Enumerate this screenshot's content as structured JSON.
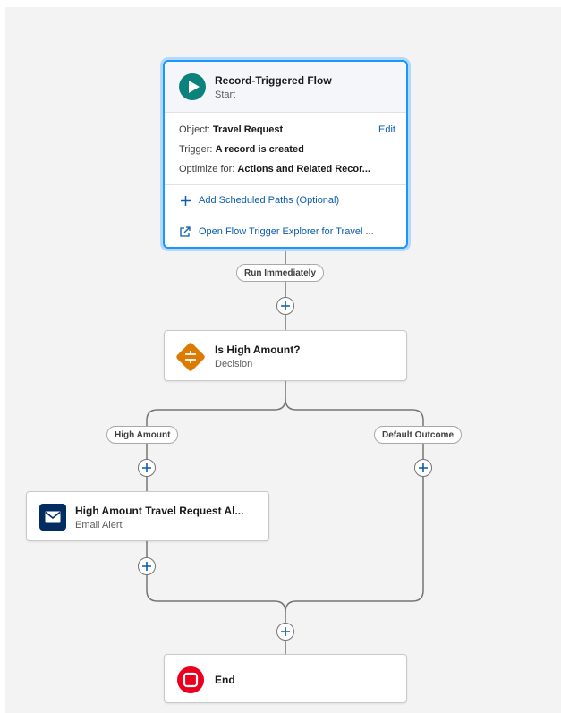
{
  "start": {
    "title": "Record-Triggered Flow",
    "subtitle": "Start",
    "object_label": "Object:",
    "object_value": "Travel Request",
    "edit_label": "Edit",
    "trigger_label": "Trigger:",
    "trigger_value": "A record is created",
    "optimize_label": "Optimize for:",
    "optimize_value": "Actions and Related Recor...",
    "add_paths_label": "Add Scheduled Paths (Optional)",
    "explorer_label": "Open Flow Trigger Explorer for Travel ..."
  },
  "connectors": {
    "run_immediately": "Run Immediately",
    "high_amount": "High Amount",
    "default_outcome": "Default Outcome"
  },
  "decision": {
    "title": "Is High Amount?",
    "subtitle": "Decision"
  },
  "email_alert": {
    "title": "High Amount Travel Request Al...",
    "subtitle": "Email Alert"
  },
  "end": {
    "title": "End"
  },
  "colors": {
    "start_icon": "#0b827c",
    "decision_icon": "#dd7a01",
    "email_icon": "#032d60",
    "end_icon": "#ea001e",
    "link": "#0b5cab",
    "selected_border": "#1b96ff"
  },
  "icons": {
    "start": "play-icon",
    "decision": "decision-icon",
    "email": "envelope-icon",
    "end": "stop-icon",
    "add": "plus-icon",
    "external": "external-link-icon"
  }
}
